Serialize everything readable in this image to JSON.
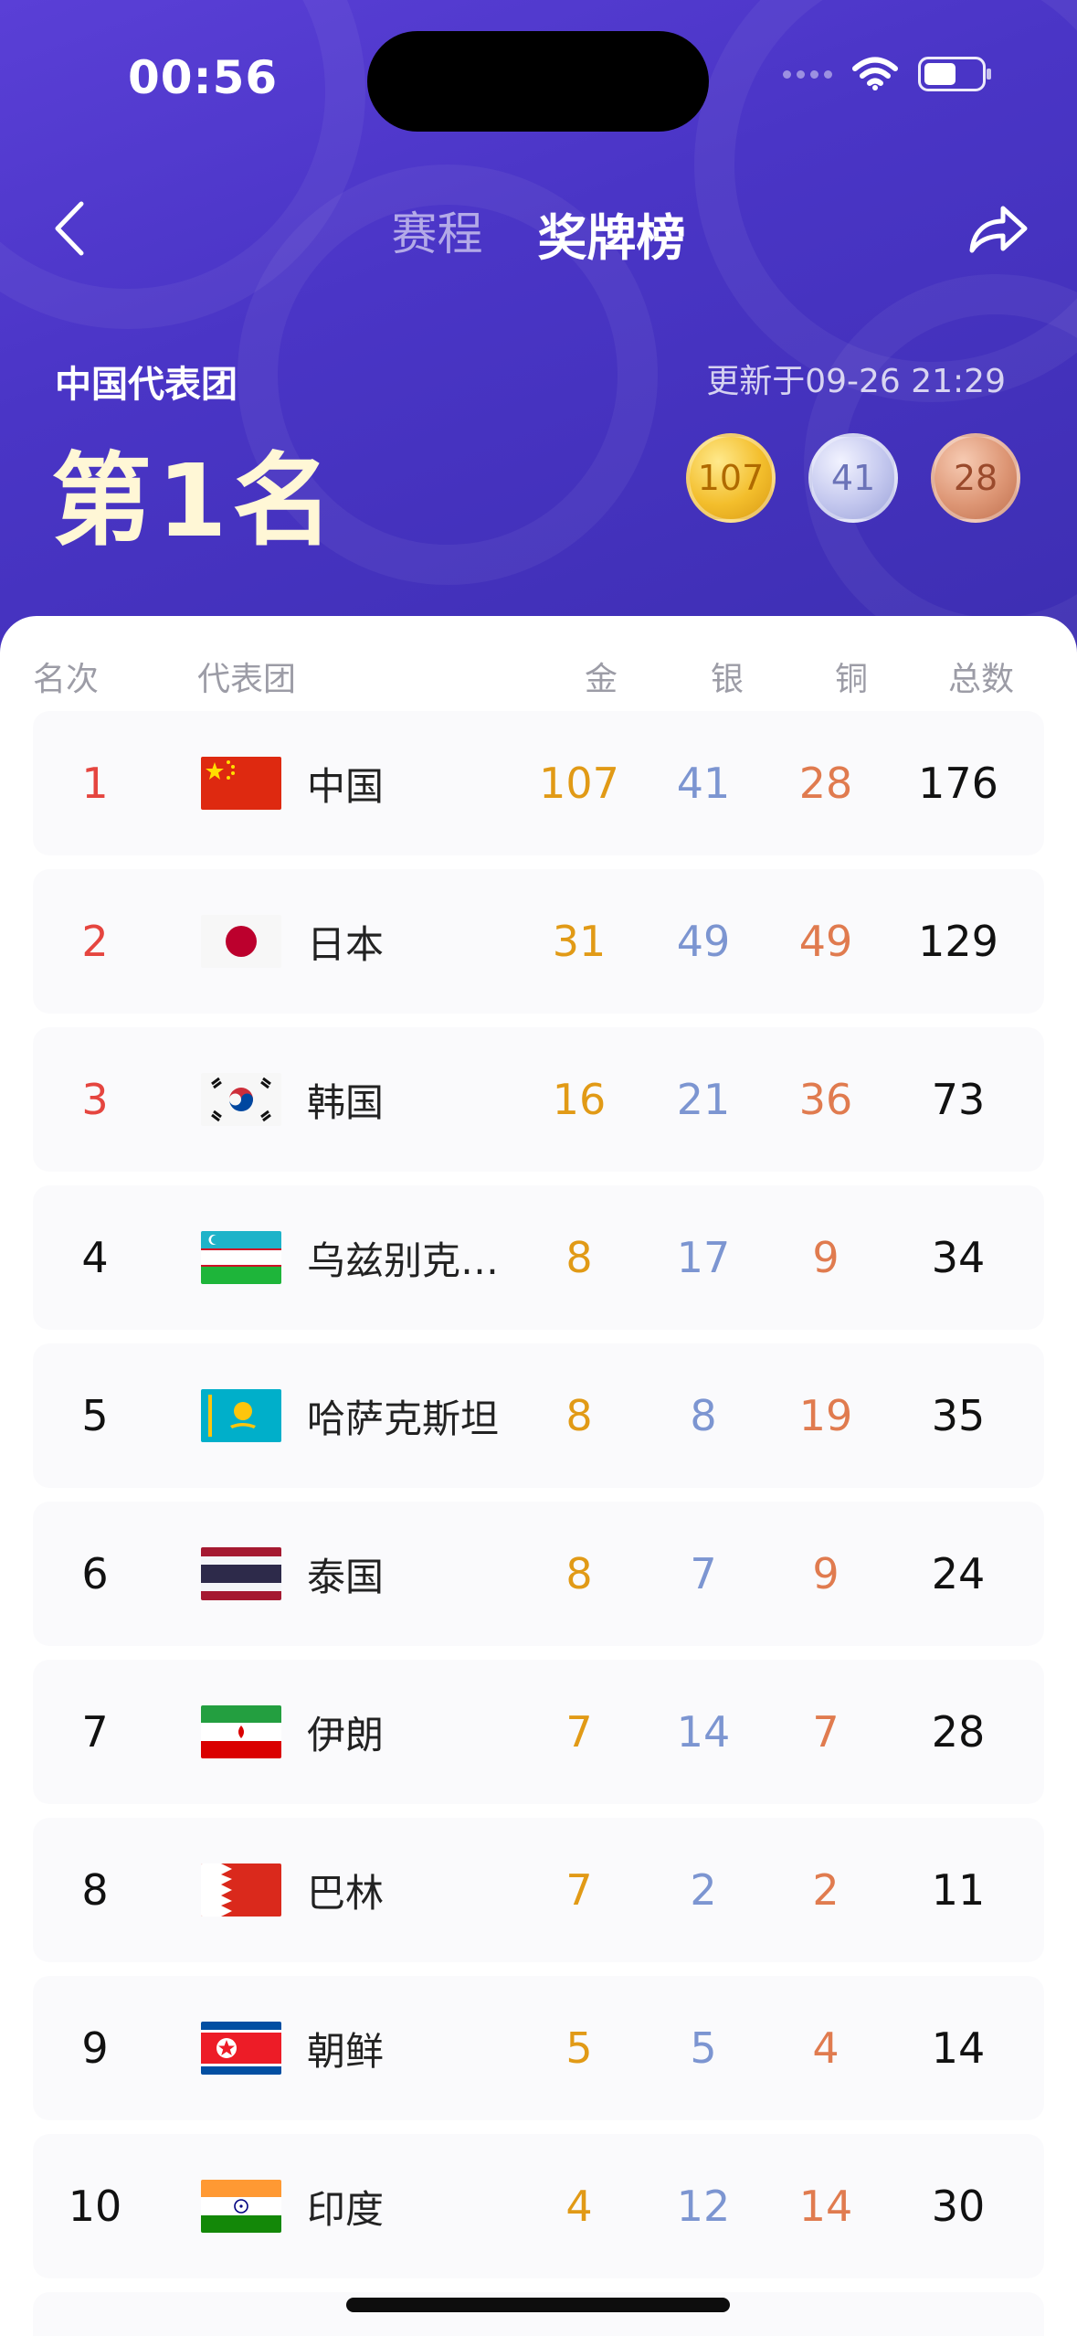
{
  "status_bar": {
    "time": "00:56"
  },
  "nav": {
    "back_icon": "chevron-left-icon",
    "share_icon": "share-arrow-icon",
    "tabs": [
      {
        "label": "赛程",
        "active": false
      },
      {
        "label": "奖牌榜",
        "active": true
      }
    ]
  },
  "summary": {
    "team": "中国代表团",
    "rank_label": "第1名",
    "updated": "更新于09-26 21:29",
    "gold": "107",
    "silver": "41",
    "bronze": "28"
  },
  "table": {
    "headers": {
      "rank": "名次",
      "team": "代表团",
      "gold": "金",
      "silver": "银",
      "bronze": "铜",
      "total": "总数"
    },
    "rows": [
      {
        "rank": "1",
        "flag": "china-flag",
        "name": "中国",
        "gold": "107",
        "silver": "41",
        "bronze": "28",
        "total": "176"
      },
      {
        "rank": "2",
        "flag": "japan-flag",
        "name": "日本",
        "gold": "31",
        "silver": "49",
        "bronze": "49",
        "total": "129"
      },
      {
        "rank": "3",
        "flag": "korea-flag",
        "name": "韩国",
        "gold": "16",
        "silver": "21",
        "bronze": "36",
        "total": "73"
      },
      {
        "rank": "4",
        "flag": "uzbekistan-flag",
        "name": "乌兹别克…",
        "gold": "8",
        "silver": "17",
        "bronze": "9",
        "total": "34"
      },
      {
        "rank": "5",
        "flag": "kazakhstan-flag",
        "name": "哈萨克斯坦",
        "gold": "8",
        "silver": "8",
        "bronze": "19",
        "total": "35"
      },
      {
        "rank": "6",
        "flag": "thailand-flag",
        "name": "泰国",
        "gold": "8",
        "silver": "7",
        "bronze": "9",
        "total": "24"
      },
      {
        "rank": "7",
        "flag": "iran-flag",
        "name": "伊朗",
        "gold": "7",
        "silver": "14",
        "bronze": "7",
        "total": "28"
      },
      {
        "rank": "8",
        "flag": "bahrain-flag",
        "name": "巴林",
        "gold": "7",
        "silver": "2",
        "bronze": "2",
        "total": "11"
      },
      {
        "rank": "9",
        "flag": "north-korea-flag",
        "name": "朝鲜",
        "gold": "5",
        "silver": "5",
        "bronze": "4",
        "total": "14"
      },
      {
        "rank": "10",
        "flag": "india-flag",
        "name": "印度",
        "gold": "4",
        "silver": "12",
        "bronze": "14",
        "total": "30"
      }
    ]
  },
  "colors": {
    "header_bg": "#4a35c6",
    "gold": "#e19a16",
    "silver": "#7c95d1",
    "bronze": "#e07b4f",
    "top_rank": "#e5453f"
  }
}
